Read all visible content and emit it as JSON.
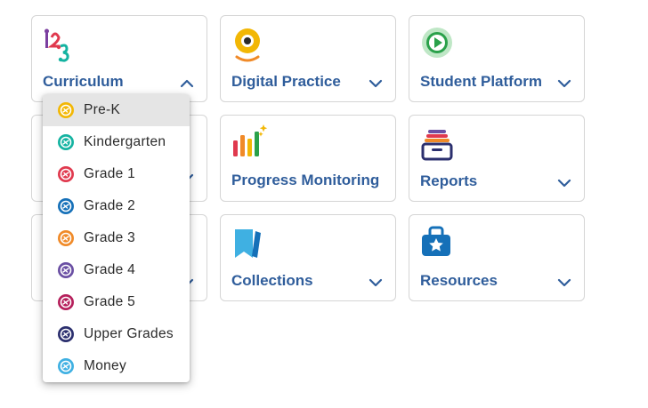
{
  "tiles": [
    {
      "label": "Curriculum",
      "icon": "abc-123-icon",
      "chevron": "up"
    },
    {
      "label": "Digital Practice",
      "icon": "webcam-icon",
      "chevron": "down"
    },
    {
      "label": "Student Platform",
      "icon": "play-circle-icon",
      "chevron": "down"
    },
    {
      "label": "Progress Monitoring",
      "icon": "bar-chart-icon",
      "chevron": "none"
    },
    {
      "label": "Reports",
      "icon": "stacked-tray-icon",
      "chevron": "down"
    },
    {
      "label": "Collections",
      "icon": "bookmark-folder-icon",
      "chevron": "down"
    },
    {
      "label": "Resources",
      "icon": "toolbox-star-icon",
      "chevron": "down"
    }
  ],
  "grade_menu": {
    "items": [
      {
        "label": "Pre-K",
        "color": "#f2b705"
      },
      {
        "label": "Kindergarten",
        "color": "#14b3a1"
      },
      {
        "label": "Grade 1",
        "color": "#e0394e"
      },
      {
        "label": "Grade 2",
        "color": "#1570b8"
      },
      {
        "label": "Grade 3",
        "color": "#f08a28"
      },
      {
        "label": "Grade 4",
        "color": "#6a4fa3"
      },
      {
        "label": "Grade 5",
        "color": "#b51f5b"
      },
      {
        "label": "Upper Grades",
        "color": "#2b2f6e"
      },
      {
        "label": "Money",
        "color": "#3fb0e2"
      }
    ],
    "selected_index": 0
  },
  "colors": {
    "label_blue": "#2f5d9b",
    "tile_border": "#d5d5d5",
    "selected_bg": "#e5e5e5"
  }
}
